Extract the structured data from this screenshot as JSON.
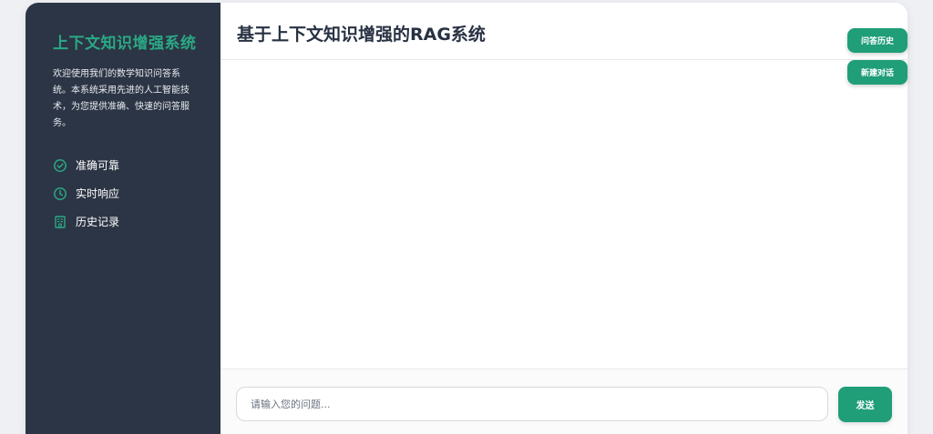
{
  "sidebar": {
    "title": "上下文知识增强系统",
    "description": "欢迎使用我们的数学知识问答系统。本系统采用先进的人工智能技术，为您提供准确、快速的问答服务。",
    "features": [
      {
        "icon": "check-circle-icon",
        "label": "准确可靠"
      },
      {
        "icon": "clock-icon",
        "label": "实时响应"
      },
      {
        "icon": "building-icon",
        "label": "历史记录"
      }
    ]
  },
  "main": {
    "title": "基于上下文知识增强的RAG系统"
  },
  "input": {
    "value": "",
    "placeholder": "请输入您的问题...",
    "send_label": "发送"
  },
  "actions": {
    "history_label": "问答历史",
    "new_chat_label": "新建对话"
  },
  "colors": {
    "accent": "#1f9e78",
    "sidebar_bg": "#2c3545",
    "title_green": "#2aa985"
  }
}
